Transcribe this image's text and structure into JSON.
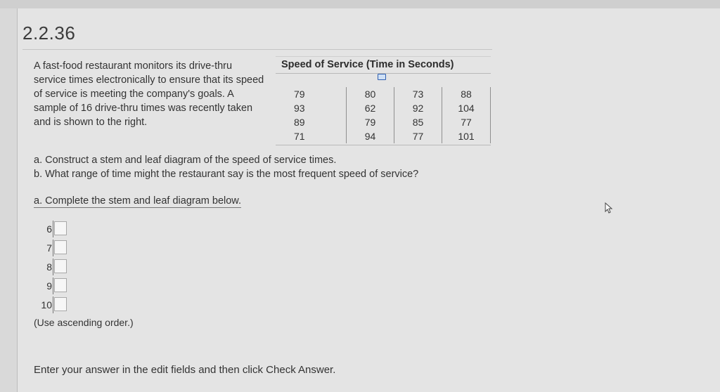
{
  "problem": {
    "id": "2.2.36",
    "intro": "A fast-food restaurant monitors its drive-thru service times electronically to ensure that its speed of service is meeting the company's goals. A sample of 16 drive-thru times was recently taken and is shown to the right."
  },
  "table": {
    "title": "Speed of Service (Time in Seconds)",
    "rows": [
      [
        "79",
        "80",
        "73",
        "88"
      ],
      [
        "93",
        "62",
        "92",
        "104"
      ],
      [
        "89",
        "79",
        "85",
        "77"
      ],
      [
        "71",
        "94",
        "77",
        "101"
      ]
    ]
  },
  "questions": {
    "a": "a. Construct a stem and leaf diagram of the speed of service times.",
    "b": "b. What range of time might the restaurant say is the most frequent speed of service?"
  },
  "part_a": {
    "instruction": "a. Complete the stem and leaf diagram below.",
    "stems": [
      "6",
      "7",
      "8",
      "9",
      "10"
    ],
    "note": "(Use ascending order.)"
  },
  "footer": {
    "text": "Enter your answer in the edit fields and then click Check Answer."
  }
}
